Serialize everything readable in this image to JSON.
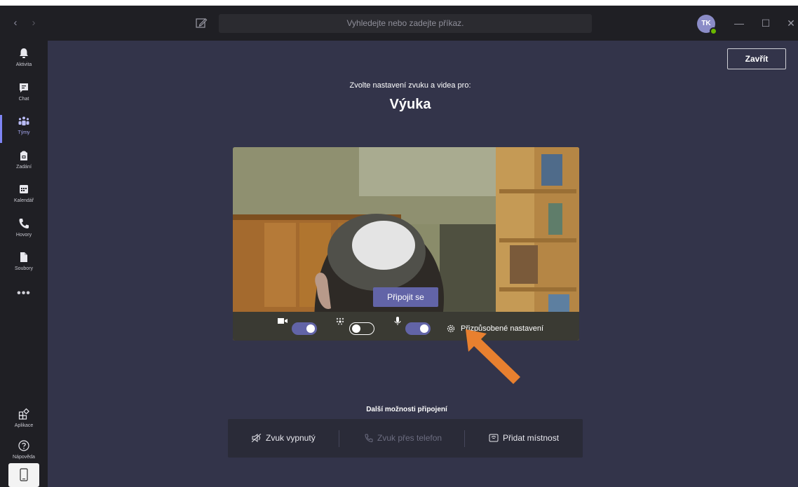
{
  "titlebar": {
    "back_icon": "chevron-left-icon",
    "forward_icon": "chevron-right-icon",
    "compose_icon": "compose-icon",
    "search_placeholder": "Vyhledejte nebo zadejte příkaz.",
    "avatar_initials": "TK",
    "presence_status_color": "#6bb700",
    "minimize_icon": "minimize-icon",
    "maximize_icon": "maximize-icon",
    "close_icon": "close-icon"
  },
  "rail": {
    "items": [
      {
        "label": "Aktivita",
        "icon": "bell-icon"
      },
      {
        "label": "Chat",
        "icon": "chat-icon"
      },
      {
        "label": "Týmy",
        "icon": "teams-icon",
        "active": true
      },
      {
        "label": "Zadání",
        "icon": "assignments-icon"
      },
      {
        "label": "Kalendář",
        "icon": "calendar-icon"
      },
      {
        "label": "Hovory",
        "icon": "phone-icon"
      },
      {
        "label": "Soubory",
        "icon": "files-icon"
      }
    ],
    "more_label": "•••",
    "apps_label": "Aplikace",
    "help_label": "Nápověda"
  },
  "main": {
    "close_label": "Zavřít",
    "subtitle": "Zvolte nastavení zvuku a videa pro:",
    "meeting_title": "Výuka",
    "join_label": "Připojit se",
    "camera_toggle_on": true,
    "blur_toggle_on": false,
    "mic_toggle_on": true,
    "custom_settings_label": "Přizpůsobené nastavení",
    "more_options_title": "Další možnosti připojení",
    "options": [
      {
        "label": "Zvuk vypnutý",
        "icon": "speaker-off-icon",
        "enabled": true
      },
      {
        "label": "Zvuk přes telefon",
        "icon": "phone-icon",
        "enabled": false
      },
      {
        "label": "Přidat místnost",
        "icon": "room-icon",
        "enabled": true
      }
    ]
  },
  "colors": {
    "accent": "#6264a7",
    "background": "#33344a",
    "chrome": "#1f1f24",
    "annotation_arrow": "#e8802f"
  }
}
